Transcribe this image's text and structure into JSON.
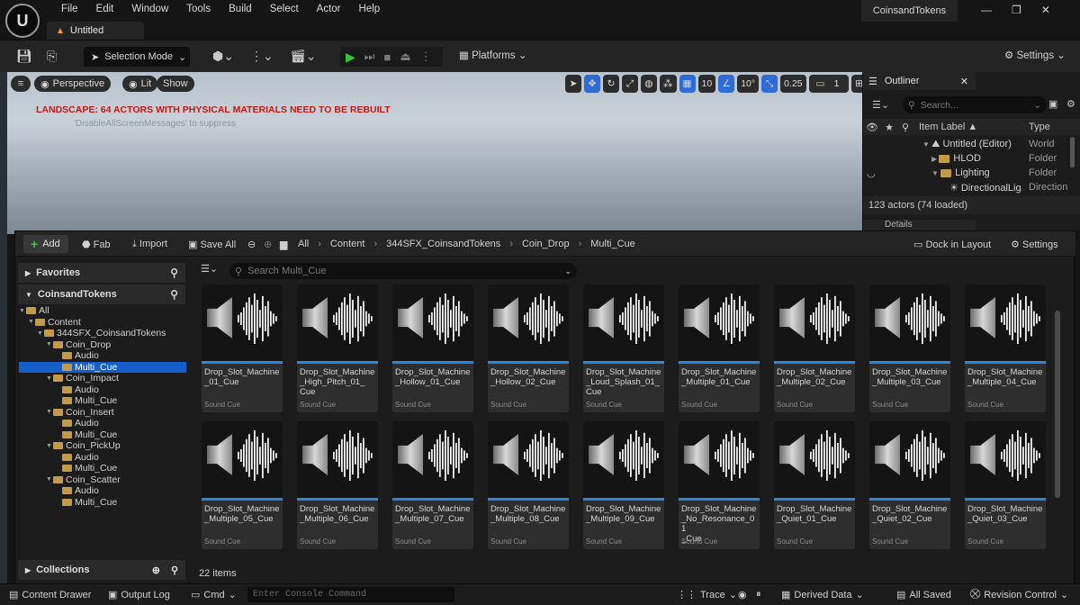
{
  "menubar": {
    "items": [
      "File",
      "Edit",
      "Window",
      "Tools",
      "Build",
      "Select",
      "Actor",
      "Help"
    ],
    "doc_tab": "Untitled",
    "project": "CoinsandTokens"
  },
  "toolbar": {
    "mode": "Selection Mode",
    "platforms": "Platforms",
    "settings": "Settings"
  },
  "viewport": {
    "perspective": "Perspective",
    "lit": "Lit",
    "show": "Show",
    "grid": "10",
    "angle": "10°",
    "scale": "0.25",
    "cam": "1",
    "warning": "LANDSCAPE: 64 ACTORS WITH PHYSICAL MATERIALS NEED TO BE REBUILT",
    "suppress": "'DisableAllScreenMessages' to suppress"
  },
  "outliner": {
    "title": "Outliner",
    "search": "Search...",
    "col_label": "Item Label ▲",
    "col_type": "Type",
    "rows": [
      {
        "label": "Untitled (Editor)",
        "type": "World"
      },
      {
        "label": "HLOD",
        "type": "Folder"
      },
      {
        "label": "Lighting",
        "type": "Folder"
      },
      {
        "label": "DirectionalLig",
        "type": "Direction"
      }
    ],
    "status": "123 actors (74 loaded)",
    "details": "Details"
  },
  "content_browser": {
    "add": "Add",
    "fab": "Fab",
    "import": "Import",
    "save_all": "Save All",
    "crumbs": [
      "All",
      "Content",
      "344SFX_CoinsandTokens",
      "Coin_Drop",
      "Multi_Cue"
    ],
    "dock": "Dock in Layout",
    "settings": "Settings",
    "favorites": "Favorites",
    "source": "CoinsandTokens",
    "collections": "Collections",
    "search": "Search Multi_Cue",
    "tree": [
      {
        "label": "All",
        "indent": 0,
        "sel": false
      },
      {
        "label": "Content",
        "indent": 1,
        "sel": false
      },
      {
        "label": "344SFX_CoinsandTokens",
        "indent": 2,
        "sel": false
      },
      {
        "label": "Coin_Drop",
        "indent": 3,
        "sel": false
      },
      {
        "label": "Audio",
        "indent": 4,
        "sel": false
      },
      {
        "label": "Multi_Cue",
        "indent": 4,
        "sel": true
      },
      {
        "label": "Coin_Impact",
        "indent": 3,
        "sel": false
      },
      {
        "label": "Audio",
        "indent": 4,
        "sel": false
      },
      {
        "label": "Multi_Cue",
        "indent": 4,
        "sel": false
      },
      {
        "label": "Coin_Insert",
        "indent": 3,
        "sel": false
      },
      {
        "label": "Audio",
        "indent": 4,
        "sel": false
      },
      {
        "label": "Multi_Cue",
        "indent": 4,
        "sel": false
      },
      {
        "label": "Coin_PickUp",
        "indent": 3,
        "sel": false
      },
      {
        "label": "Audio",
        "indent": 4,
        "sel": false
      },
      {
        "label": "Multi_Cue",
        "indent": 4,
        "sel": false
      },
      {
        "label": "Coin_Scatter",
        "indent": 3,
        "sel": false
      },
      {
        "label": "Audio",
        "indent": 4,
        "sel": false
      },
      {
        "label": "Multi_Cue",
        "indent": 4,
        "sel": false
      }
    ],
    "asset_type": "Sound Cue",
    "assets": [
      "Drop_Slot_Machine_01_Cue",
      "Drop_Slot_Machine_High_Pitch_01_Cue",
      "Drop_Slot_Machine_Hollow_01_Cue",
      "Drop_Slot_Machine_Hollow_02_Cue",
      "Drop_Slot_Machine_Loud_Splash_01_Cue",
      "Drop_Slot_Machine_Multiple_01_Cue",
      "Drop_Slot_Machine_Multiple_02_Cue",
      "Drop_Slot_Machine_Multiple_03_Cue",
      "Drop_Slot_Machine_Multiple_04_Cue",
      "Drop_Slot_Machine_Multiple_05_Cue",
      "Drop_Slot_Machine_Multiple_06_Cue",
      "Drop_Slot_Machine_Multiple_07_Cue",
      "Drop_Slot_Machine_Multiple_08_Cue",
      "Drop_Slot_Machine_Multiple_09_Cue",
      "Drop_Slot_Machine_No_Resonance_01_Cue",
      "Drop_Slot_Machine_Quiet_01_Cue",
      "Drop_Slot_Machine_Quiet_02_Cue",
      "Drop_Slot_Machine_Quiet_03_Cue"
    ],
    "asset_names": [
      "Drop_Slot_Machine\n_01_Cue",
      "Drop_Slot_Machine\n_High_Pitch_01_\nCue",
      "Drop_Slot_Machine\n_Hollow_01_Cue",
      "Drop_Slot_Machine\n_Hollow_02_Cue",
      "Drop_Slot_Machine\n_Loud_Splash_01_\nCue",
      "Drop_Slot_Machine\n_Multiple_01_Cue",
      "Drop_Slot_Machine\n_Multiple_02_Cue",
      "Drop_Slot_Machine\n_Multiple_03_Cue",
      "Drop_Slot_Machine\n_Multiple_04_Cue",
      "Drop_Slot_Machine\n_Multiple_05_Cue",
      "Drop_Slot_Machine\n_Multiple_06_Cue",
      "Drop_Slot_Machine\n_Multiple_07_Cue",
      "Drop_Slot_Machine\n_Multiple_08_Cue",
      "Drop_Slot_Machine\n_Multiple_09_Cue",
      "Drop_Slot_Machine\n_No_Resonance_01\n_Cue",
      "Drop_Slot_Machine\n_Quiet_01_Cue",
      "Drop_Slot_Machine\n_Quiet_02_Cue",
      "Drop_Slot_Machine\n_Quiet_03_Cue"
    ],
    "count": "22 items"
  },
  "statusbar": {
    "content_drawer": "Content Drawer",
    "output_log": "Output Log",
    "cmd": "Cmd",
    "cmd_placeholder": "Enter Console Command",
    "trace": "Trace",
    "derived": "Derived Data",
    "saved": "All Saved",
    "revision": "Revision Control"
  }
}
